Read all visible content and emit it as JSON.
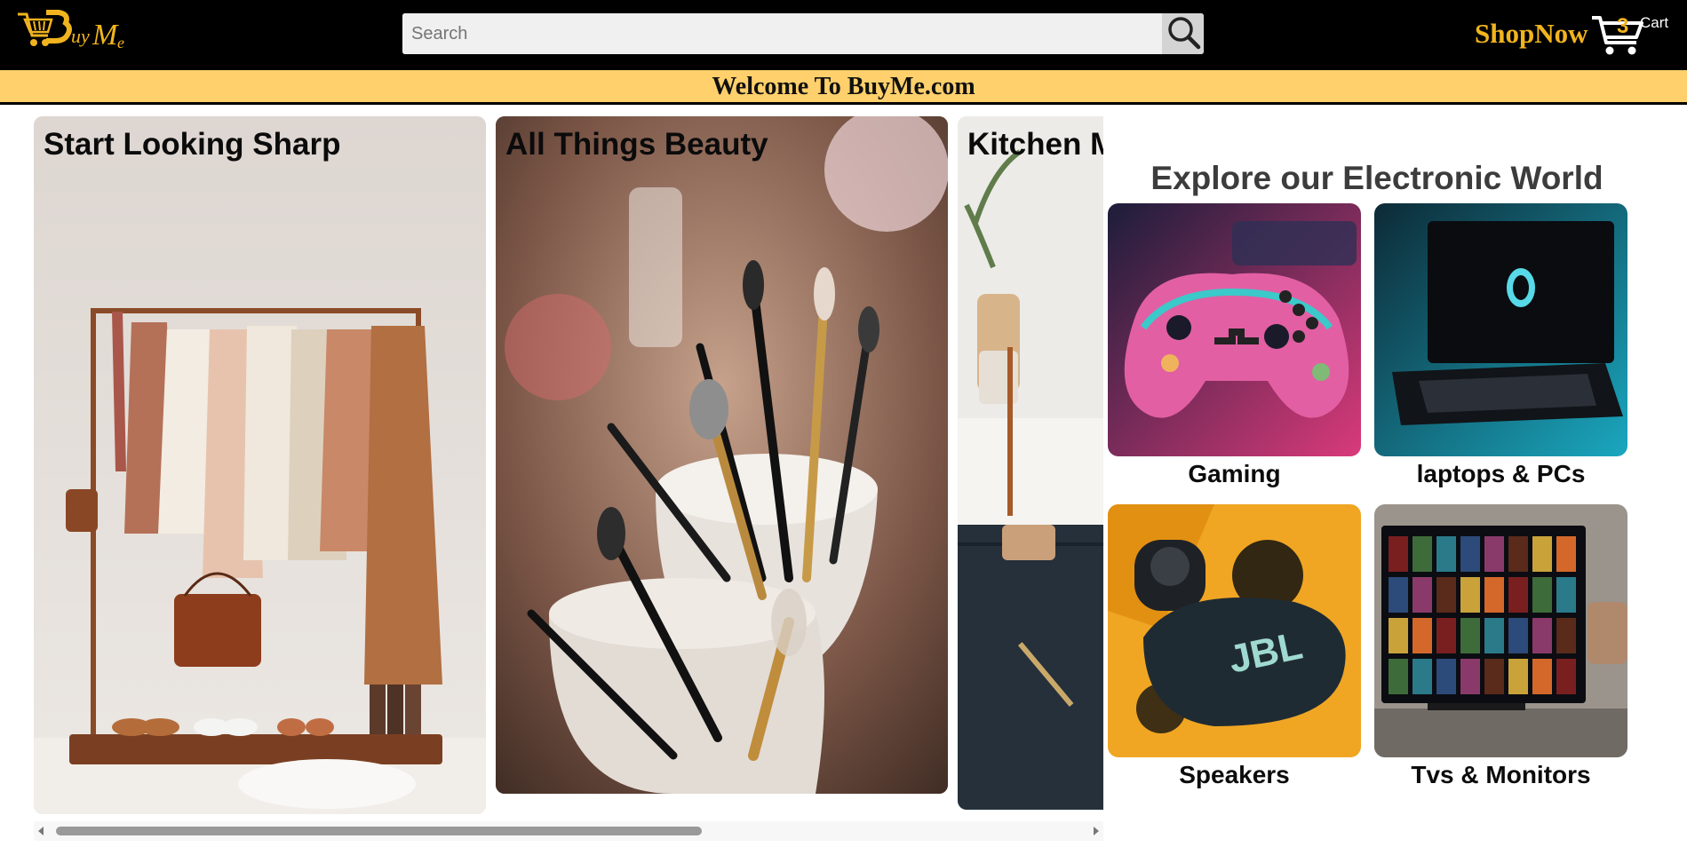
{
  "header": {
    "logo_text": "BuyMe",
    "search_placeholder": "Search",
    "search_value": "",
    "shop_now": "ShopNow",
    "cart_count": "3",
    "cart_label": "Cart",
    "colors": {
      "background": "#000000",
      "accent": "#f1b41e"
    }
  },
  "banner": {
    "text": "Welcome To BuyMe.com",
    "background": "#ffd06b"
  },
  "categories": [
    {
      "title": "Start Looking Sharp",
      "image": "clothing-rack-image"
    },
    {
      "title": "All Things Beauty",
      "image": "makeup-brushes-image"
    },
    {
      "title": "Kitchen M",
      "image": "kitchen-counter-image"
    }
  ],
  "carousel_scroll": {
    "position_fraction": 0.0,
    "visible_fraction": 0.63
  },
  "electronics": {
    "title": "Explore our Electronic World",
    "items": [
      {
        "label": "Gaming",
        "image": "game-controller-image"
      },
      {
        "label": "laptops & PCs",
        "image": "laptop-image"
      },
      {
        "label": "Speakers",
        "image": "jbl-speaker-image"
      },
      {
        "label": "Tvs & Monitors",
        "image": "smart-tv-image"
      }
    ]
  }
}
